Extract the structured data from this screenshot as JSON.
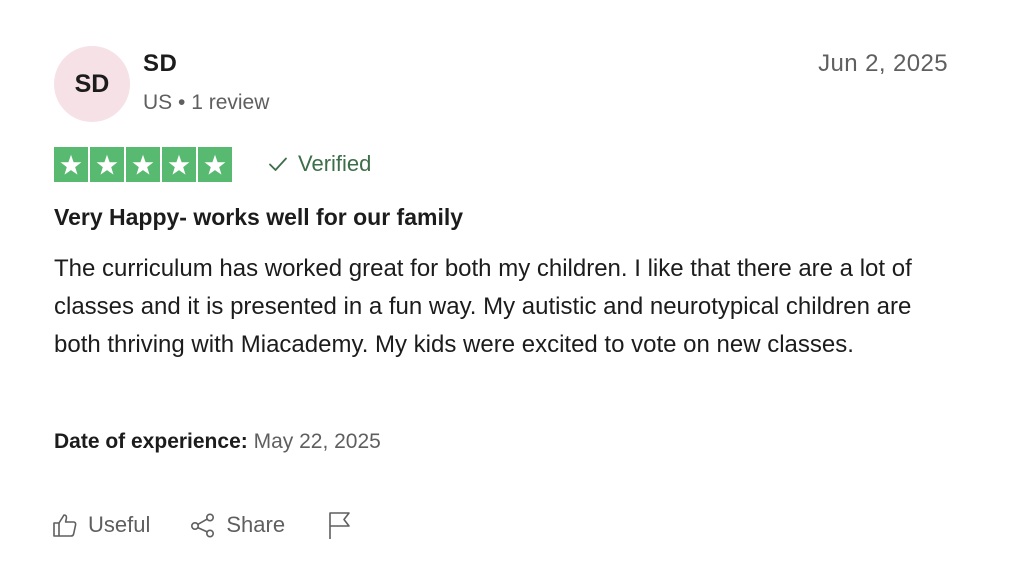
{
  "reviewer": {
    "initials": "SD",
    "name": "SD",
    "meta": "US • 1 review"
  },
  "review": {
    "date": "Jun 2, 2025",
    "rating": 5,
    "rating_max": 5,
    "star_color": "#58ba71",
    "verified_label": "Verified",
    "title": "Very Happy- works well for our family",
    "body": "The curriculum has worked great for both my children. I like that there are a lot of classes and it is presented in a fun way. My autistic and neurotypical children are both thriving with Miacademy. My kids were excited to vote on new classes.",
    "experience_label": "Date of experience:",
    "experience_date": "May 22, 2025"
  },
  "actions": {
    "useful_label": "Useful",
    "share_label": "Share",
    "flag_icon": "flag-icon"
  }
}
